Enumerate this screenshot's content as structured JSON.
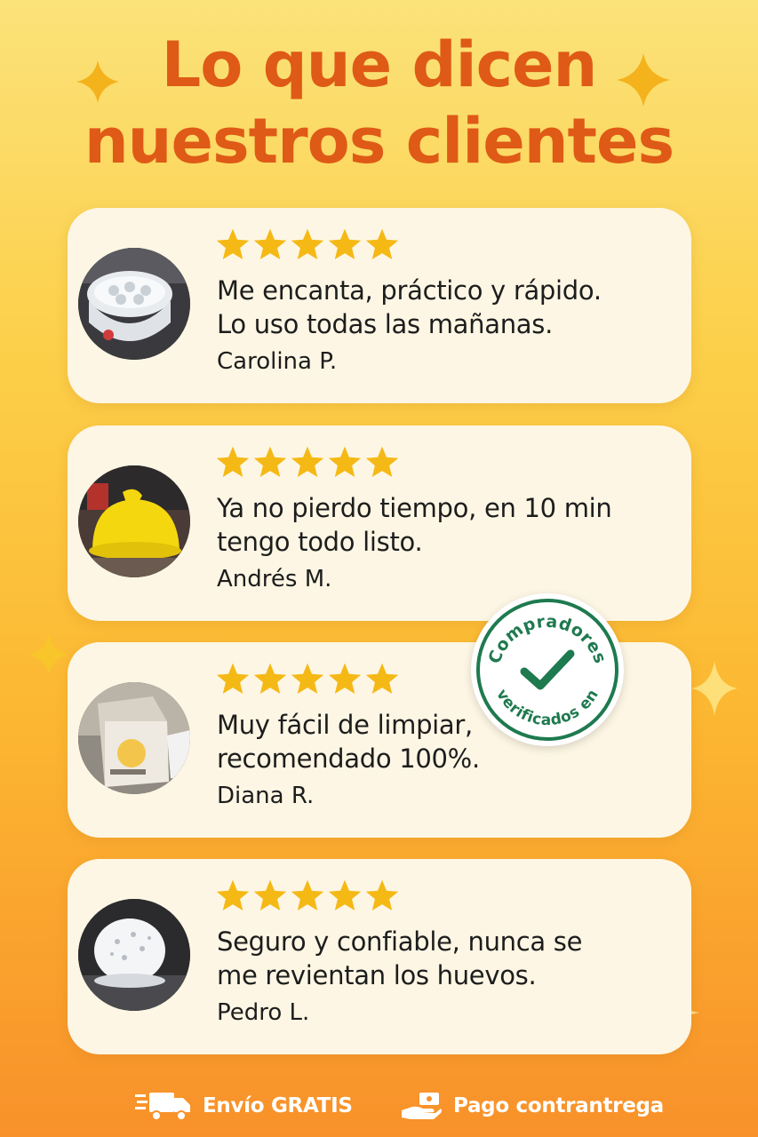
{
  "title": {
    "line1": "Lo que dicen",
    "line2": "nuestros clientes"
  },
  "colors": {
    "title": "#df5a16",
    "star": "#f5b916",
    "badge_green": "#1e7a4f",
    "card_bg": "#fdf6e4"
  },
  "reviews": [
    {
      "rating": 5,
      "line1": "Me encanta, práctico y rápido.",
      "line2": "Lo uso todas las mañanas.",
      "author": "Carolina P.",
      "photo_icon": "egg-cooker-photo"
    },
    {
      "rating": 5,
      "line1": "Ya no pierdo tiempo, en 10 min",
      "line2": "tengo todo listo.",
      "author": "Andrés M.",
      "photo_icon": "yellow-cooker-photo"
    },
    {
      "rating": 5,
      "line1": "Muy fácil de limpiar,",
      "line2": "recomendado 100%.",
      "author": "Diana R.",
      "photo_icon": "product-box-photo"
    },
    {
      "rating": 5,
      "line1": "Seguro y confiable, nunca se",
      "line2": "me revientan los huevos.",
      "author": "Pedro L.",
      "photo_icon": "white-cooker-photo"
    }
  ],
  "badge": {
    "top_text": "Compradores",
    "bottom_text": "verificados en"
  },
  "footer": {
    "shipping_label": "Envío GRATIS",
    "payment_label": "Pago contrantrega"
  }
}
